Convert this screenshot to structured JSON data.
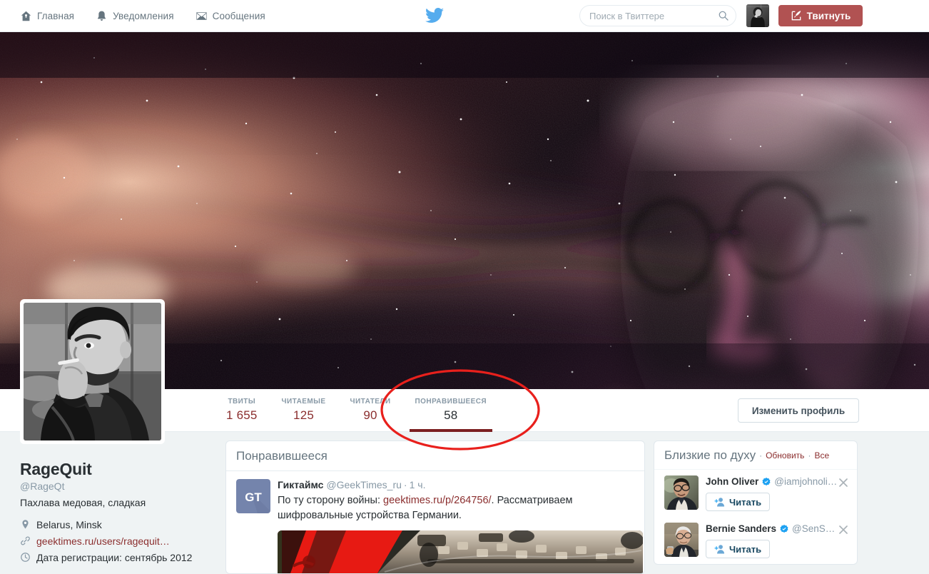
{
  "nav": {
    "items": [
      {
        "label": "Главная",
        "icon": "home-icon"
      },
      {
        "label": "Уведомления",
        "icon": "bell-icon"
      },
      {
        "label": "Сообщения",
        "icon": "envelope-icon"
      }
    ],
    "logo_icon": "twitter-bird-logo",
    "search": {
      "placeholder": "Поиск в Твиттере",
      "value": "",
      "icon": "search-icon"
    },
    "avatar_icon": "user-avatar",
    "tweet_button": {
      "label": "Твитнуть",
      "icon": "quill-icon",
      "color": "#b15252"
    }
  },
  "profile": {
    "name": "RageQuit",
    "handle": "@RageQt",
    "bio": "Пахлава медовая, сладкая",
    "meta": [
      {
        "icon": "location-pin-icon",
        "text": "Belarus, Minsk",
        "link": false
      },
      {
        "icon": "link-icon",
        "text": "geektimes.ru/users/ragequit…",
        "link": true
      },
      {
        "icon": "clock-icon",
        "text": "Дата регистрации: сентябрь 2012",
        "link": false
      }
    ],
    "avatar_icon": "profile-avatar",
    "edit_button": "Изменить профиль"
  },
  "stats": [
    {
      "key": "ТВИТЫ",
      "value": "1 655",
      "active": false
    },
    {
      "key": "ЧИТАЕМЫЕ",
      "value": "125",
      "active": false
    },
    {
      "key": "ЧИТАТЕЛИ",
      "value": "90",
      "active": false
    },
    {
      "key": "ПОНРАВИВШЕЕСЯ",
      "value": "58",
      "active": true
    }
  ],
  "timeline": {
    "header": "Понравившееся",
    "tweets": [
      {
        "avatar_icon": "geektimes-gt-logo",
        "name": "Гиктаймс",
        "handle": "@GeekTimes_ru",
        "separator": "·",
        "time": "1 ч.",
        "text_before": "По ту сторону войны: ",
        "link": "geektimes.ru/p/264756/",
        "text_after": ". Рассматриваем шифровальные устройства Германии.",
        "media_icon": "tweet-photo"
      }
    ]
  },
  "who_to_follow": {
    "title": "Близкие по духу",
    "dot": "·",
    "refresh_label": "Обновить",
    "all_label": "Все",
    "items": [
      {
        "avatar_icon": "john-oliver-avatar",
        "name": "John Oliver",
        "verified": true,
        "handle": "@iamjohnoli…",
        "follow_label": "Читать",
        "follow_icon": "add-person-icon",
        "close_icon": "close-icon"
      },
      {
        "avatar_icon": "bernie-sanders-avatar",
        "name": "Bernie Sanders",
        "verified": true,
        "handle": "@SenS…",
        "follow_label": "Читать",
        "follow_icon": "add-person-icon",
        "close_icon": "close-icon"
      }
    ]
  },
  "annotation": {
    "shape": "ellipse",
    "color": "#e8201c",
    "target": "ПОНРАВИВШЕЕСЯ"
  },
  "theme": {
    "accent": "#b15252",
    "link": "#8b2e2e",
    "page_bg": "#eff3f4",
    "text": "#292f33",
    "muted": "#8899a6",
    "verified_blue": "#1da1f2"
  }
}
